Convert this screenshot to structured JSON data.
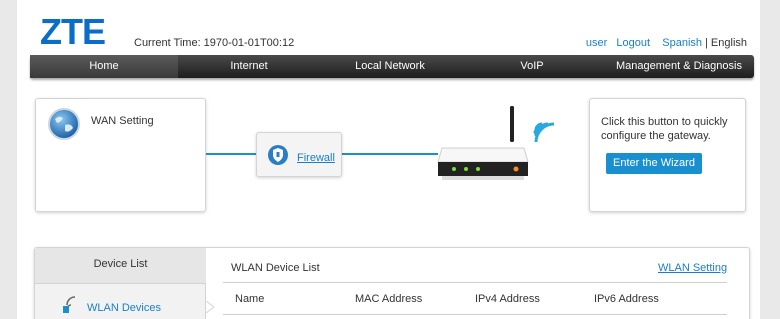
{
  "header": {
    "logo": "ZTE",
    "current_time": "Current Time: 1970-01-01T00:12",
    "links": {
      "user": "user",
      "logout": "Logout",
      "spanish": "Spanish",
      "separator": "|",
      "english": "English"
    }
  },
  "nav": {
    "items": [
      {
        "label": "Home",
        "active": true
      },
      {
        "label": "Internet",
        "active": false
      },
      {
        "label": "Local Network",
        "active": false
      },
      {
        "label": "VoIP",
        "active": false
      },
      {
        "label": "Management & Diagnosis",
        "active": false
      }
    ]
  },
  "topology": {
    "wan_label": "WAN Setting",
    "firewall_label": "Firewall",
    "wizard_text": "Click this button to quickly configure the gateway.",
    "wizard_button": "Enter the Wizard"
  },
  "device_panel": {
    "side_title": "Device List",
    "side_item": "WLAN Devices",
    "title": "WLAN Device List",
    "link": "WLAN Setting",
    "columns": [
      "Name",
      "MAC Address",
      "IPv4 Address",
      "IPv6 Address"
    ]
  },
  "colors": {
    "accent": "#1a8fd0",
    "logo": "#0a6ec8",
    "nav_bg": "#2a2a2a"
  }
}
